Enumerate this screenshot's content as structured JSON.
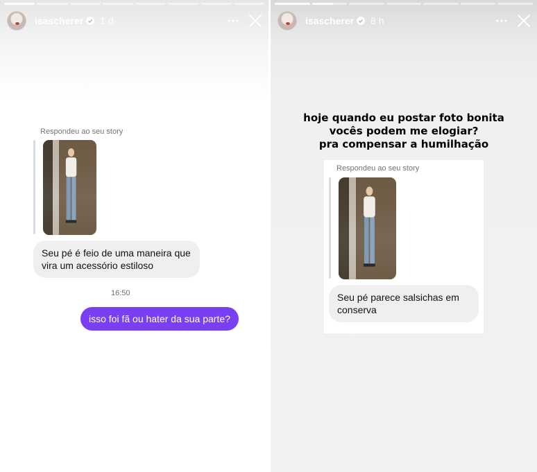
{
  "left_story": {
    "progress": [
      1,
      0,
      0,
      0,
      0,
      0,
      0,
      0
    ],
    "username": "isascherer",
    "time": "1 d",
    "reply_label": "Respondeu ao seu story",
    "received_message": "Seu pé é feio de uma maneira que vira um acessório estiloso",
    "timestamp": "16:50",
    "sent_message": "isso foi fã ou hater da sua parte?"
  },
  "right_story": {
    "progress": [
      1,
      0.6,
      0,
      0,
      0,
      0,
      0
    ],
    "username": "isascherer",
    "time": "8 h",
    "caption_lines": [
      "hoje quando eu postar foto bonita",
      "vocês podem me elogiar?",
      "pra compensar a humilhação"
    ],
    "reply_label": "Respondeu ao seu story",
    "received_message": "Seu pé parece salsichas em conserva"
  },
  "icons": {
    "more": "more-horizontal-icon",
    "close": "close-icon",
    "verified": "verified-badge-icon"
  },
  "colors": {
    "sent_bubble": "#7b3ff2",
    "received_bubble": "#efefef"
  }
}
